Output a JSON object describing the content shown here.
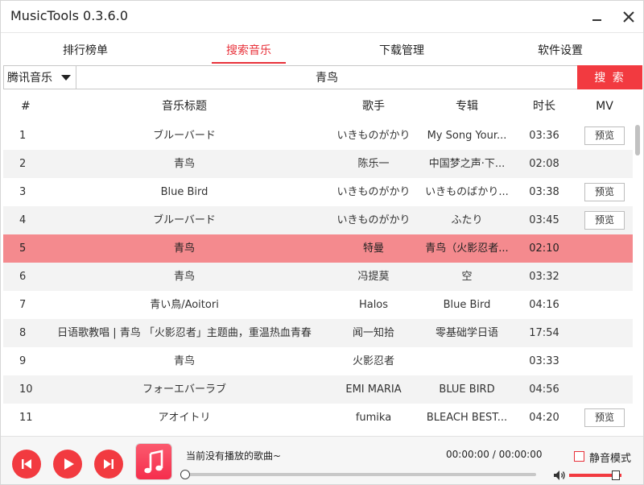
{
  "app": {
    "title": "MusicTools 0.3.6.0"
  },
  "nav": {
    "tabs": [
      {
        "label": "排行榜单"
      },
      {
        "label": "搜索音乐"
      },
      {
        "label": "下载管理"
      },
      {
        "label": "软件设置"
      }
    ],
    "active_index": 1
  },
  "search": {
    "source": "腾讯音乐",
    "query": "青鸟",
    "button_label": "搜 索"
  },
  "table": {
    "headers": {
      "num": "#",
      "title": "音乐标题",
      "artist": "歌手",
      "album": "专辑",
      "duration": "时长",
      "mv": "MV"
    },
    "rows": [
      {
        "num": "1",
        "title": "ブルーバード",
        "artist": "いきものがかり",
        "album": "My Song Your...",
        "duration": "03:36",
        "mv": "预览"
      },
      {
        "num": "2",
        "title": "青鸟",
        "artist": "陈乐一",
        "album": "中国梦之声·下...",
        "duration": "02:08",
        "mv": ""
      },
      {
        "num": "3",
        "title": "Blue Bird",
        "artist": "いきものがかり",
        "album": "いきものばかり...",
        "duration": "03:38",
        "mv": "预览"
      },
      {
        "num": "4",
        "title": "ブルーバード",
        "artist": "いきものがかり",
        "album": "ふたり",
        "duration": "03:45",
        "mv": "预览"
      },
      {
        "num": "5",
        "title": "青鸟",
        "artist": "特曼",
        "album": "青鸟（火影忍者...",
        "duration": "02:10",
        "mv": ""
      },
      {
        "num": "6",
        "title": "青鸟",
        "artist": "冯提莫",
        "album": "空",
        "duration": "03:32",
        "mv": ""
      },
      {
        "num": "7",
        "title": "青い鳥/Aoitori",
        "artist": "Halos",
        "album": "Blue Bird",
        "duration": "04:16",
        "mv": ""
      },
      {
        "num": "8",
        "title": "日语歌教唱 | 青鸟 「火影忍者」主题曲，重温热血青春",
        "artist": "闻一知拾",
        "album": "零基础学日语",
        "duration": "17:54",
        "mv": ""
      },
      {
        "num": "9",
        "title": "青鸟",
        "artist": "火影忍者",
        "album": "",
        "duration": "03:33",
        "mv": ""
      },
      {
        "num": "10",
        "title": "フォーエバーラブ",
        "artist": "EMI MARIA",
        "album": "BLUE BIRD",
        "duration": "04:56",
        "mv": ""
      },
      {
        "num": "11",
        "title": "アオイトリ",
        "artist": "fumika",
        "album": "BLEACH BEST...",
        "duration": "04:20",
        "mv": "预览"
      }
    ],
    "selected_index": 4
  },
  "player": {
    "now_playing": "当前没有播放的歌曲~",
    "time": "00:00:00 / 00:00:00",
    "progress": 0,
    "mute_label": "静音模式",
    "mute_checked": false,
    "volume": 0.85
  },
  "colors": {
    "accent": "#f23a40",
    "selected_row": "#f48a8e",
    "stripe": "#f3f3f3"
  }
}
